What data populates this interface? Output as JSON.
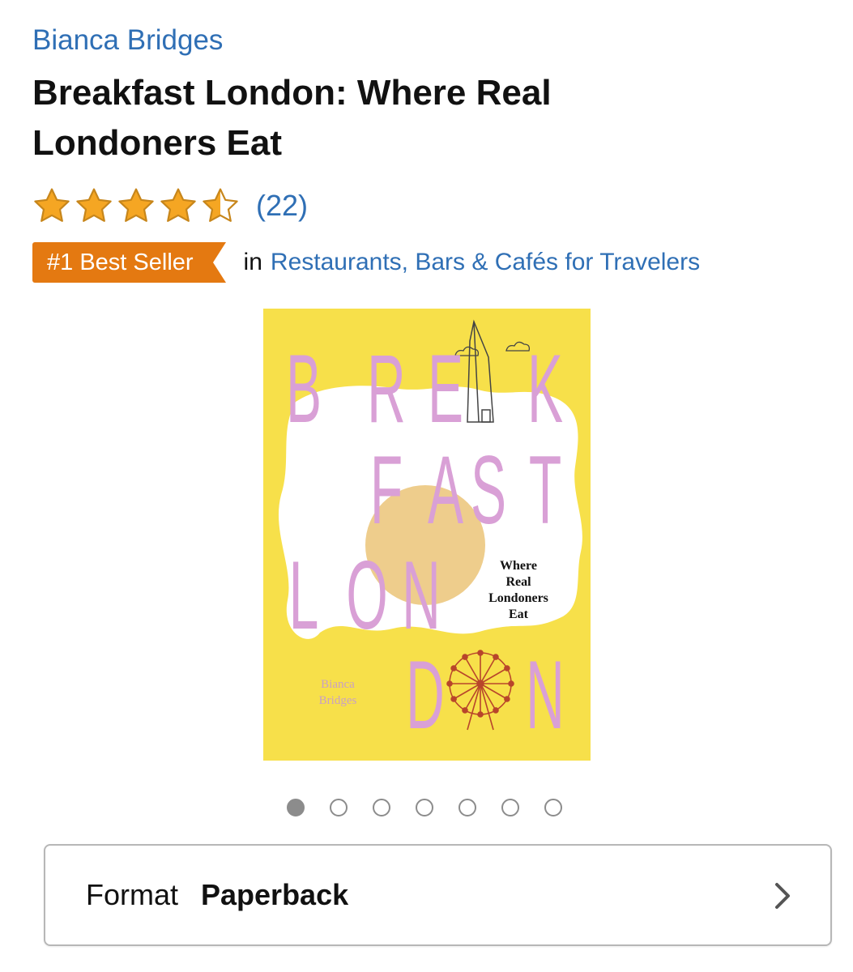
{
  "author": "Bianca Bridges",
  "title": "Breakfast London: Where Real Londoners Eat",
  "rating": {
    "stars": 4.5,
    "max": 5,
    "review_count": "(22)"
  },
  "best_seller": {
    "badge": "#1 Best Seller",
    "in_label": "in",
    "category": "Restaurants, Bars & Cafés for Travelers"
  },
  "cover": {
    "row1": [
      "B",
      "R",
      "E",
      "K"
    ],
    "row2": [
      "F",
      "A",
      "S",
      "T"
    ],
    "row3": [
      "L",
      "O",
      "N"
    ],
    "row4": [
      "D",
      "N"
    ],
    "subtitle": [
      "Where",
      "Real",
      "Londoners",
      "Eat"
    ],
    "author": [
      "Bianca",
      "Bridges"
    ],
    "colors": {
      "background": "#f7e04a",
      "letters": "#d9a0d6",
      "yolk": "#eecd8c",
      "egg_white": "#ffffff"
    }
  },
  "carousel": {
    "count": 7,
    "active": 0
  },
  "format": {
    "label": "Format",
    "value": "Paperback"
  },
  "colors": {
    "link": "#2f6fb5",
    "badge": "#e47911",
    "star": "#f5a623"
  }
}
